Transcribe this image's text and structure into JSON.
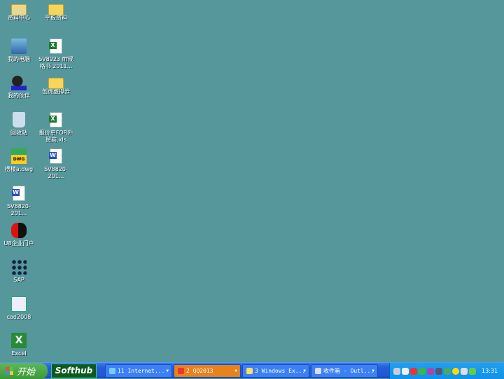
{
  "desktop_icons": [
    {
      "label": "资料中心",
      "icon": "briefcase-icon"
    },
    {
      "label": "平板资料",
      "icon": "folder-icon"
    },
    {
      "label": "我的电脑",
      "icon": "computer-icon"
    },
    {
      "label": "SV8923 fff规格书 2011...",
      "icon": "excel-file-icon"
    },
    {
      "label": "我的伙伴",
      "icon": "people-icon"
    },
    {
      "label": "创虎虚拟云",
      "icon": "folder-icon"
    },
    {
      "label": "回收站",
      "icon": "recycle-bin-icon"
    },
    {
      "label": "报价单FOR外贸商.xls",
      "icon": "excel-file-icon"
    },
    {
      "label": "楞楼a.dwg",
      "icon": "dwg-file-icon"
    },
    {
      "label": "SV8820-201...",
      "icon": "word-file-icon"
    },
    {
      "label": "SV8820-201...",
      "icon": "word-file-icon"
    },
    {
      "label": "U8企业门户",
      "icon": "u8-icon"
    },
    {
      "label": "SAP",
      "icon": "sap-icon"
    },
    {
      "label": "cad2008",
      "icon": "autocad-icon"
    },
    {
      "label": "Excel",
      "icon": "excel-icon"
    }
  ],
  "taskbar": {
    "start_label": "开始",
    "quicklaunch_label": "Softhub",
    "tasks": [
      {
        "label": "11 Internet...",
        "icon": "ie-icon",
        "color": "#3c81f3"
      },
      {
        "label": "2 QQ2013",
        "icon": "qq-icon",
        "color": "#e8821a"
      },
      {
        "label": "3 Windows Ex...",
        "icon": "folder-icon",
        "color": "#3c81f3"
      },
      {
        "label": "收件箱 - Outl...",
        "icon": "outlook-icon",
        "color": "#3c81f3"
      }
    ],
    "clock": "13:31"
  }
}
